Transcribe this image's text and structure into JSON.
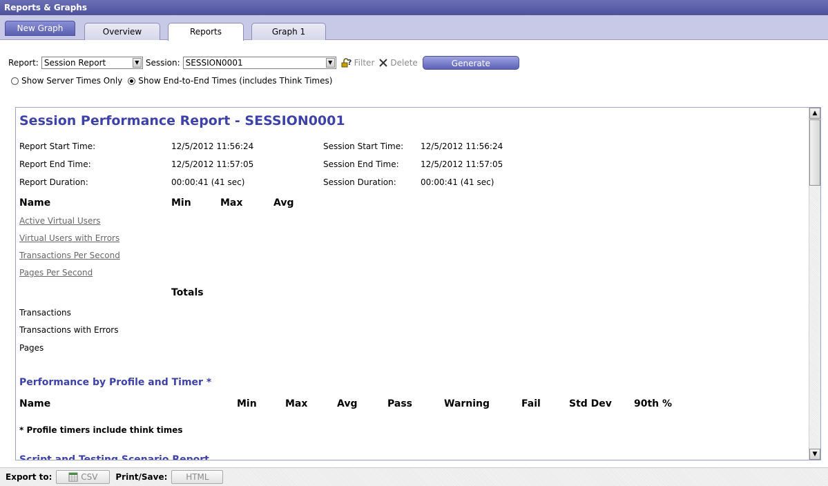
{
  "window": {
    "title": "Reports & Graphs"
  },
  "tabs": {
    "new_graph": "New Graph",
    "items": [
      {
        "label": "Overview",
        "active": false
      },
      {
        "label": "Reports",
        "active": true
      },
      {
        "label": "Graph 1",
        "active": false
      }
    ]
  },
  "toolbar": {
    "report_label": "Report:",
    "report_value": "Session Report",
    "session_label": "Session:",
    "session_value": "SESSION0001",
    "filter_label": "Filter",
    "delete_label": "Delete",
    "generate_label": "Generate",
    "radio_server": "Show Server Times Only",
    "radio_end_to_end": "Show End-to-End Times (includes Think Times)",
    "selected_radio": "end_to_end"
  },
  "report": {
    "title": "Session Performance Report - SESSION0001",
    "meta": {
      "report_start_label": "Report Start Time:",
      "report_start_value": "12/5/2012 11:56:24",
      "report_end_label": "Report End Time:",
      "report_end_value": "12/5/2012 11:57:05",
      "report_duration_label": "Report Duration:",
      "report_duration_value": "00:00:41 (41 sec)",
      "session_start_label": "Session Start Time:",
      "session_start_value": "12/5/2012 11:56:24",
      "session_end_label": "Session End Time:",
      "session_end_value": "12/5/2012 11:57:05",
      "session_duration_label": "Session Duration:",
      "session_duration_value": "00:00:41 (41 sec)"
    },
    "stats_headers": {
      "name": "Name",
      "min": "Min",
      "max": "Max",
      "avg": "Avg"
    },
    "stats_rows": [
      "Active Virtual Users",
      "Virtual Users with Errors",
      "Transactions Per Second",
      "Pages Per Second"
    ],
    "totals_header": "Totals",
    "totals_rows": [
      "Transactions",
      "Transactions with Errors",
      "Pages"
    ],
    "profile_section": {
      "title": "Performance by Profile and Timer *",
      "headers": {
        "name": "Name",
        "min": "Min",
        "max": "Max",
        "avg": "Avg",
        "pass": "Pass",
        "warning": "Warning",
        "fail": "Fail",
        "std_dev": "Std Dev",
        "p90": "90th %"
      },
      "footnote": "* Profile timers include think times"
    },
    "next_section_partial": "Script and Testing Scenario Report"
  },
  "bottom": {
    "export_label": "Export to:",
    "csv_label": "CSV",
    "print_label": "Print/Save:",
    "html_label": "HTML"
  },
  "colors": {
    "accent": "#3d42a8",
    "tabbar": "#c8c9e6",
    "titlebar": "#5a5fa8"
  }
}
